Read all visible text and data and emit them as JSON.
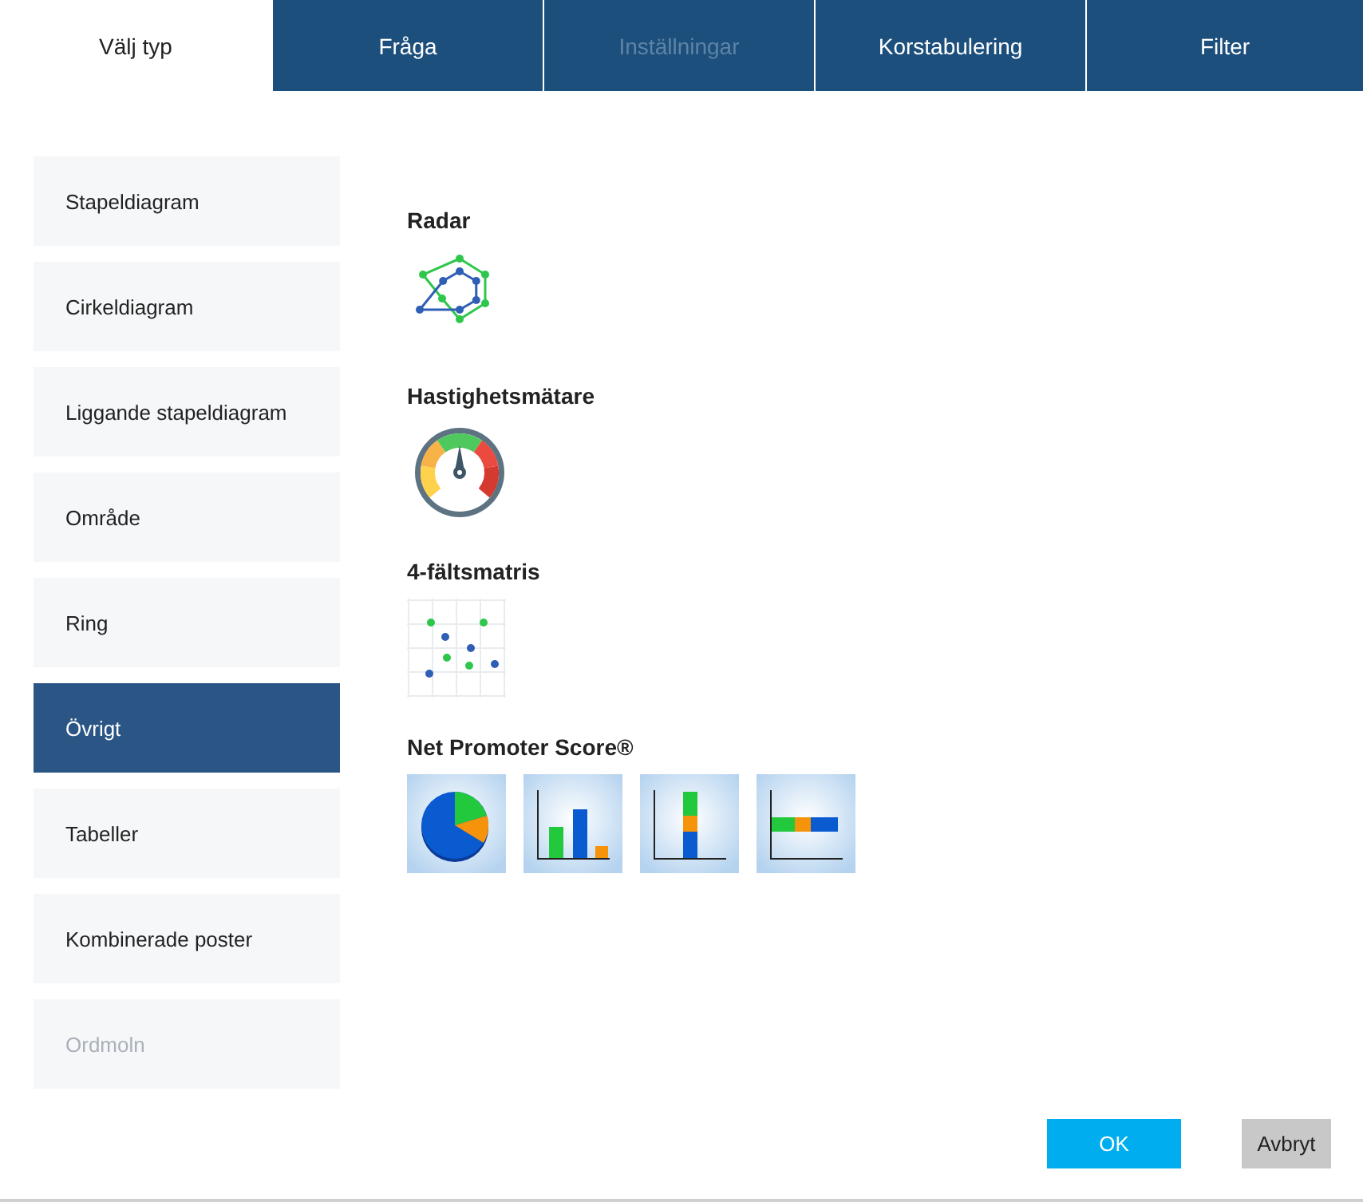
{
  "tabs": [
    {
      "label": "Välj typ",
      "selected": true,
      "disabled": false
    },
    {
      "label": "Fråga",
      "selected": false,
      "disabled": false
    },
    {
      "label": "Inställningar",
      "selected": false,
      "disabled": true
    },
    {
      "label": "Korstabulering",
      "selected": false,
      "disabled": false
    },
    {
      "label": "Filter",
      "selected": false,
      "disabled": false
    }
  ],
  "sidebar": {
    "items": [
      {
        "label": "Stapeldiagram",
        "selected": false,
        "disabled": false
      },
      {
        "label": "Cirkeldiagram",
        "selected": false,
        "disabled": false
      },
      {
        "label": "Liggande stapeldiagram",
        "selected": false,
        "disabled": false
      },
      {
        "label": "Område",
        "selected": false,
        "disabled": false
      },
      {
        "label": "Ring",
        "selected": false,
        "disabled": false
      },
      {
        "label": "Övrigt",
        "selected": true,
        "disabled": false
      },
      {
        "label": "Tabeller",
        "selected": false,
        "disabled": false
      },
      {
        "label": "Kombinerade poster",
        "selected": false,
        "disabled": false
      },
      {
        "label": "Ordmoln",
        "selected": false,
        "disabled": true
      }
    ]
  },
  "sections": [
    {
      "title": "Radar",
      "options": [
        {
          "kind": "radar"
        }
      ]
    },
    {
      "title": "Hastighetsmätare",
      "options": [
        {
          "kind": "gauge"
        }
      ]
    },
    {
      "title": "4-fältsmatris",
      "options": [
        {
          "kind": "matrix"
        }
      ]
    },
    {
      "title": "Net Promoter Score®",
      "options": [
        {
          "kind": "pie"
        },
        {
          "kind": "bars"
        },
        {
          "kind": "stacked-column"
        },
        {
          "kind": "stacked-bar"
        }
      ]
    }
  ],
  "buttons": [
    {
      "label": "OK",
      "kind": "primary"
    },
    {
      "label": "Avbryt",
      "kind": "secondary"
    }
  ]
}
